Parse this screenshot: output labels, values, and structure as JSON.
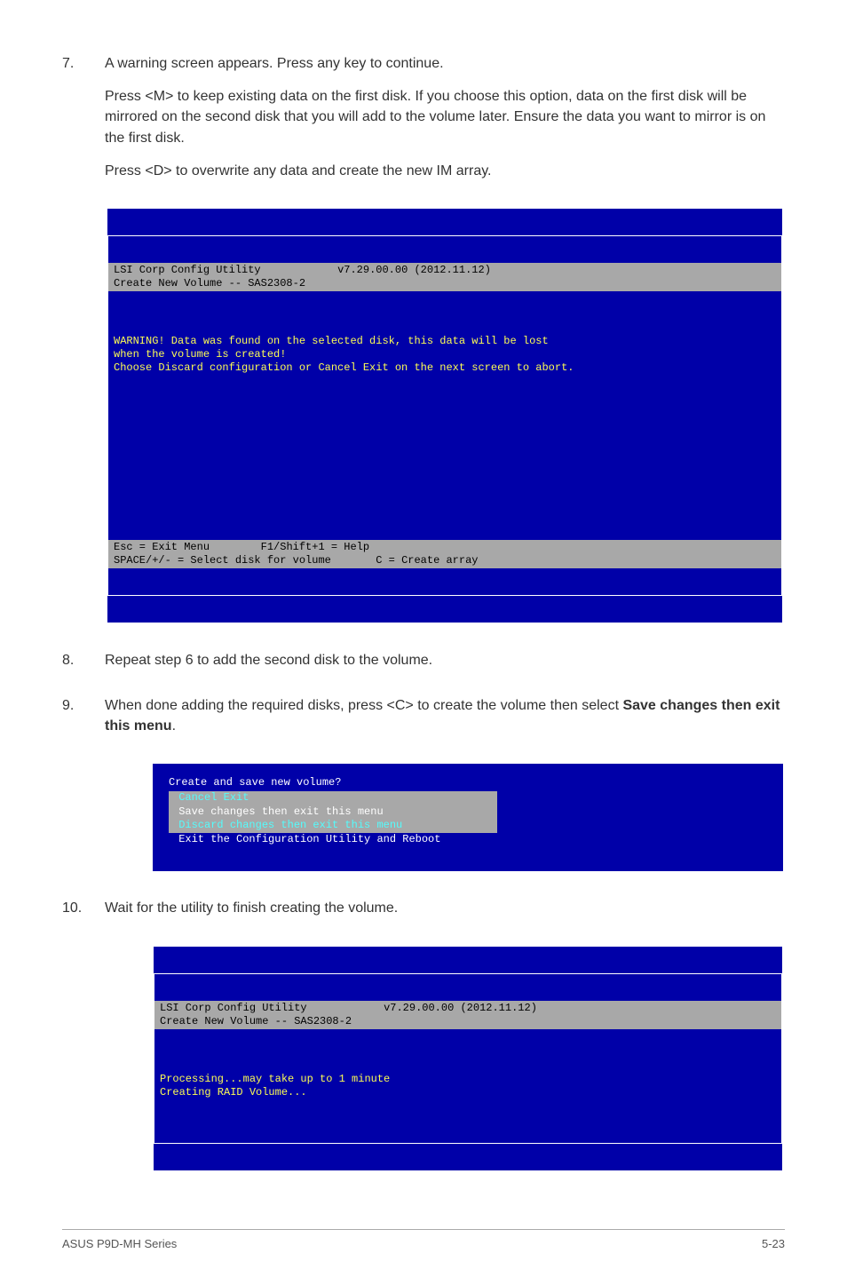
{
  "steps": {
    "s7": {
      "num": "7.",
      "line1": "A warning screen appears. Press any key to continue.",
      "line2": "Press <M> to keep existing data on the first disk. If you choose this option, data on the first disk will be mirrored on the second disk that you will add to the volume later. Ensure the data you want to mirror is on the first disk.",
      "line3": "Press <D> to overwrite any data and create the new IM array."
    },
    "s8": {
      "num": "8.",
      "text": "Repeat step 6 to add the second disk to the volume."
    },
    "s9": {
      "num": "9.",
      "text_a": "When done adding the required disks, press <C> to create the volume then select ",
      "text_b": "Save changes then exit this menu",
      "text_c": "."
    },
    "s10": {
      "num": "10.",
      "text": "Wait for the utility to finish creating the volume."
    }
  },
  "term1": {
    "hdr_left": "LSI Corp Config Utility",
    "hdr_ver": "v7.29.00.00 (2012.11.12)",
    "hdr_sub": "Create New Volume -- SAS2308-2",
    "body_l1": "WARNING! Data was found on the selected disk, this data will be lost",
    "body_l2": "when the volume is created!",
    "body_l3": "Choose Discard configuration or Cancel Exit on the next screen to abort.",
    "foot_l1a": "Esc = Exit Menu",
    "foot_l1b": "F1/Shift+1 = Help",
    "foot_l2a": "SPACE/+/- = Select disk for volume",
    "foot_l2b": "C = Create array"
  },
  "term2": {
    "title": "Create and save new volume?",
    "opt1": "Cancel Exit",
    "opt2": "Save changes then exit this menu",
    "opt3": "Discard changes then exit this menu",
    "opt4": "Exit the Configuration Utility and Reboot"
  },
  "term3": {
    "hdr_left": "LSI Corp Config Utility",
    "hdr_ver": "v7.29.00.00 (2012.11.12)",
    "hdr_sub": "Create New Volume -- SAS2308-2",
    "body_l1": "Processing...may take up to 1 minute",
    "body_l2": "Creating RAID Volume..."
  },
  "footer": {
    "left": "ASUS P9D-MH Series",
    "right": "5-23"
  }
}
